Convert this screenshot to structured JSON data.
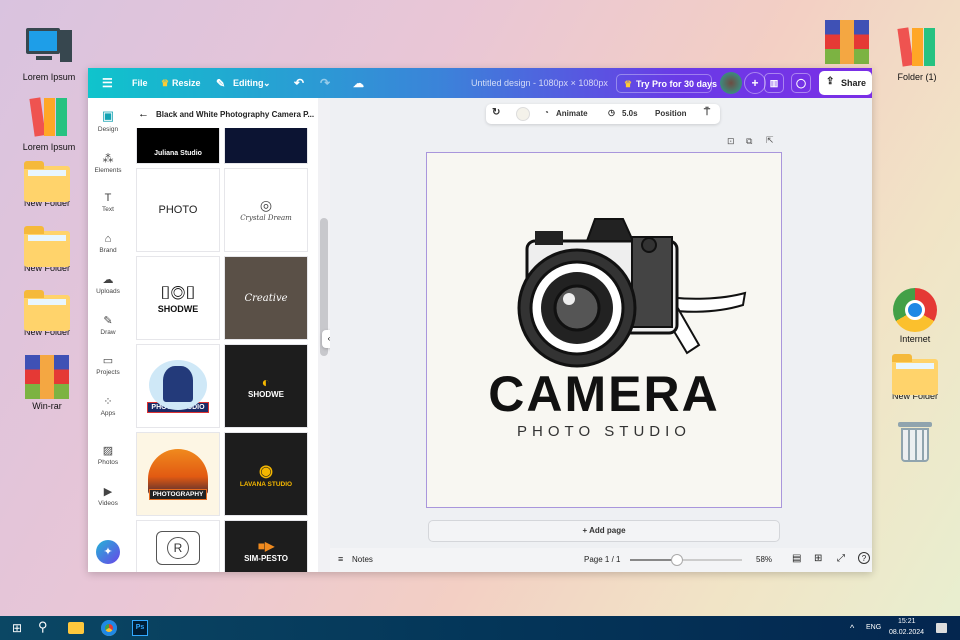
{
  "desktop": {
    "left_icons": [
      {
        "label": "Lorem Ipsum",
        "icon": "computer-icon"
      },
      {
        "label": "Lorem Ipsum",
        "icon": "binders-icon"
      },
      {
        "label": "New Folder",
        "icon": "folder-icon"
      },
      {
        "label": "New Folder",
        "icon": "folder-icon"
      },
      {
        "label": "New Folder",
        "icon": "folder-icon"
      },
      {
        "label": "Win-rar",
        "icon": "winrar-icon"
      }
    ],
    "right_icons": [
      {
        "label": "",
        "icon": "winrar-icon"
      },
      {
        "label": "Folder (1)",
        "icon": "binders-icon"
      },
      {
        "label": "Internet",
        "icon": "chrome-icon"
      },
      {
        "label": "New Folder",
        "icon": "folder-icon"
      },
      {
        "label": "",
        "icon": "recycle-bin-icon"
      }
    ]
  },
  "topbar": {
    "file": "File",
    "resize": "Resize",
    "editing": "Editing",
    "title": "Untitled design - 1080px × 1080px",
    "try_pro": "Try Pro for 30 days",
    "share": "Share"
  },
  "rail": [
    {
      "label": "Design",
      "icon": "design-icon"
    },
    {
      "label": "Elements",
      "icon": "elements-icon"
    },
    {
      "label": "Text",
      "icon": "text-icon"
    },
    {
      "label": "Brand",
      "icon": "brand-icon"
    },
    {
      "label": "Uploads",
      "icon": "uploads-icon"
    },
    {
      "label": "Draw",
      "icon": "draw-icon"
    },
    {
      "label": "Projects",
      "icon": "projects-icon"
    },
    {
      "label": "Apps",
      "icon": "apps-icon"
    },
    {
      "label": "Photos",
      "icon": "photos-icon"
    },
    {
      "label": "Videos",
      "icon": "videos-icon"
    }
  ],
  "panel": {
    "title": "Black and White Photography Camera P...",
    "thumbs": [
      "Juliana Studio",
      "",
      "PHOTO",
      "Crystal Dream",
      "SHODWE",
      "Creative",
      "PHOTO STUDIO",
      "SHODWE",
      "PHOTOGRAPHY",
      "LAVANA STUDIO",
      "R",
      "SIM-PESTO"
    ]
  },
  "toolbar": {
    "animate": "Animate",
    "duration": "5.0s",
    "position": "Position"
  },
  "design": {
    "headline": "CAMERA",
    "subline": "PHOTO STUDIO"
  },
  "add_page": "Add page",
  "bottom": {
    "notes": "Notes",
    "page": "Page 1 / 1",
    "zoom": "58%",
    "zoom_fraction": 0.42
  },
  "taskbar": {
    "lang": "ENG",
    "time": "15:21",
    "date": "08.02.2024"
  }
}
